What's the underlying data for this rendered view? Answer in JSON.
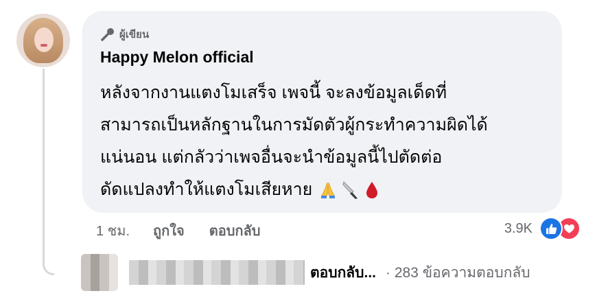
{
  "comment": {
    "badge_label": "ผู้เขียน",
    "author": "Happy Melon official",
    "text_lines": [
      "หลังจากงานแตงโมเสร็จ เพจนี้  จะลงข้อมูลเด็ดที่",
      "สามารถเป็นหลักฐานในการมัดตัวผู้กระทำความผิดได้",
      "แน่นอน  แต่กลัวว่าเพจอื่นจะนำข้อมูลนี้ไปตัดต่อ",
      "ดัดแปลงทำให้แตงโมเสียหาย"
    ],
    "emoji": [
      "folded-hands",
      "knife",
      "drop-of-blood"
    ]
  },
  "actions": {
    "time": "1 ชม.",
    "like_label": "ถูกใจ",
    "reply_label": "ตอบกลับ"
  },
  "reactions": {
    "count": "3.9K",
    "types": [
      "like",
      "love"
    ],
    "colors": {
      "like": "#1b74e4",
      "love": "#f33e58"
    }
  },
  "reply_preview": {
    "reply_text": "ตอบกลับ...",
    "count_text": "· 283 ข้อความตอบกลับ"
  }
}
